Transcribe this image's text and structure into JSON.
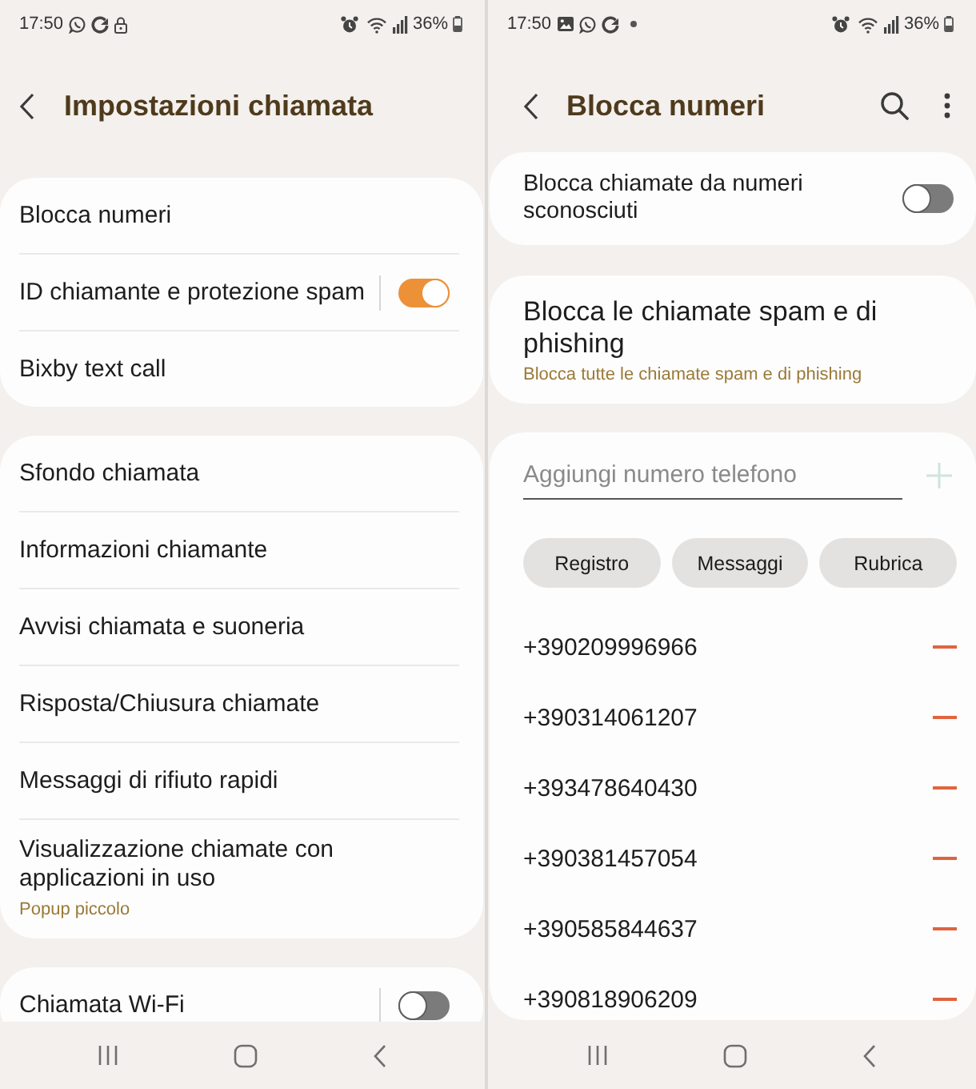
{
  "settings_screen": {
    "status_bar": {
      "time": "17:50",
      "notifications": [
        {
          "kind": "chat"
        },
        {
          "kind": "sync"
        },
        {
          "kind": "lock"
        }
      ],
      "battery": "36%"
    },
    "header": {
      "title": "Impostazioni chiamata"
    },
    "sections": [
      {
        "items": [
          {
            "kind": "link",
            "label": "Blocca numeri"
          },
          {
            "kind": "toggle",
            "label": "ID chiamante e protezione spam",
            "on": true
          },
          {
            "kind": "link",
            "label": "Bixby text call"
          }
        ]
      },
      {
        "items": [
          {
            "kind": "link",
            "label": "Sfondo chiamata"
          },
          {
            "kind": "link",
            "label": "Informazioni chiamante"
          },
          {
            "kind": "link",
            "label": "Avvisi chiamata e suoneria"
          },
          {
            "kind": "link",
            "label": "Risposta/Chiusura chiamate"
          },
          {
            "kind": "link",
            "label": "Messaggi di rifiuto rapidi"
          },
          {
            "kind": "link",
            "label": "Visualizzazione chiamate con applicazioni in uso",
            "subtitle": "Popup piccolo"
          }
        ]
      },
      {
        "items": [
          {
            "kind": "toggle",
            "label": "Chiamata Wi-Fi",
            "on": false
          }
        ]
      }
    ]
  },
  "block_screen": {
    "status_bar": {
      "time": "17:50",
      "notifications": [
        {
          "kind": "image"
        },
        {
          "kind": "chat"
        },
        {
          "kind": "sync"
        },
        {
          "kind": "dot"
        }
      ],
      "battery": "36%"
    },
    "header": {
      "title": "Blocca numeri"
    },
    "unknown_callers": {
      "label": "Blocca chiamate da numeri sconosciuti",
      "on": false
    },
    "spam_blocking": {
      "title": "Blocca le chiamate spam e di phishing",
      "subtitle": "Blocca tutte le chiamate spam e di phishing"
    },
    "add_number": {
      "placeholder": "Aggiungi numero telefono",
      "add_disabled": true
    },
    "sources": [
      {
        "label": "Registro"
      },
      {
        "label": "Messaggi"
      },
      {
        "label": "Rubrica"
      }
    ],
    "blocked_numbers": [
      {
        "number": "+390209996966"
      },
      {
        "number": "+390314061207"
      },
      {
        "number": "+393478640430"
      },
      {
        "number": "+390381457054"
      },
      {
        "number": "+390585844637"
      },
      {
        "number": "+390818906209"
      }
    ]
  }
}
